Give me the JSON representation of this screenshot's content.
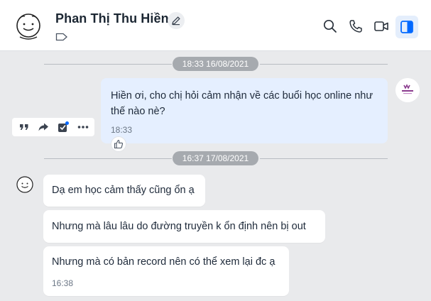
{
  "header": {
    "contact_name": "Phan Thị Thu Hiền",
    "icons": [
      "smiley-avatar-icon",
      "edit-pencil-icon",
      "tag-label-icon",
      "search-icon",
      "phone-icon",
      "video-call-icon",
      "side-panel-icon"
    ]
  },
  "conversation": {
    "dividers": [
      {
        "label": "18:33 16/08/2021"
      },
      {
        "label": "16:37 17/08/2021"
      }
    ],
    "outgoing": {
      "text": "Hiền ơi, cho chị hỏi cảm nhận về các buổi học online như thế nào nè?",
      "time": "18:33",
      "actions": [
        "quote-icon",
        "forward-icon",
        "checkbox-icon",
        "more-icon"
      ],
      "reaction": "like-icon"
    },
    "incoming": [
      {
        "text": "Dạ em học cảm thấy cũng ổn ạ"
      },
      {
        "text": "Nhưng mà lâu lâu do đường truyền k ổn định nên bị out"
      },
      {
        "text": "Nhưng mà có bản record nên có thể xem lại đc ạ",
        "time": "16:38"
      }
    ]
  },
  "colors": {
    "background": "#e9eaec",
    "outgoing_bubble": "#e5efff",
    "incoming_bubble": "#ffffff",
    "date_pill": "#a6aaaf",
    "accent": "#0068ff"
  }
}
